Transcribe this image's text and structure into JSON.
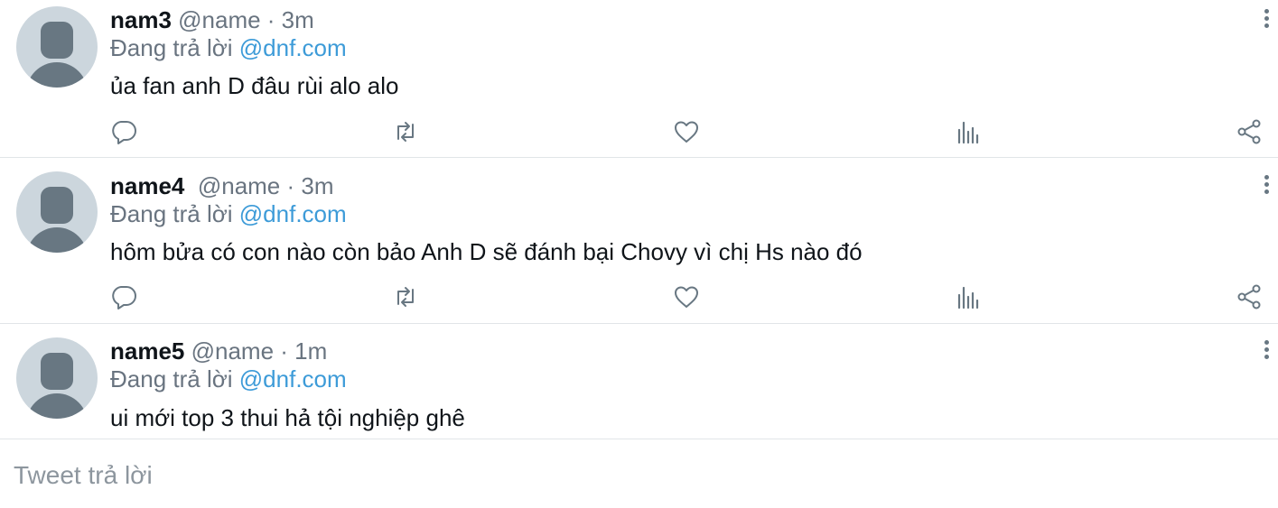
{
  "tweets": [
    {
      "name": "nam3",
      "handle_time": " @name · 3m",
      "replying_prefix": "Đang trả lời ",
      "replying_to": "@dnf.com",
      "text": "ủa fan anh D đâu rùi alo alo"
    },
    {
      "name": "name4",
      "handle_time": "  @name · 3m",
      "replying_prefix": "Đang trả lời ",
      "replying_to": "@dnf.com",
      "text": "hôm bửa có con nào còn bảo Anh D sẽ đánh bại Chovy vì chị Hs nào đó"
    },
    {
      "name": "name5",
      "handle_time": " @name · 1m",
      "replying_prefix": "Đang trả lời ",
      "replying_to": "@dnf.com",
      "text": "ui mới top 3 thui hả tội nghiệp ghê"
    }
  ],
  "icons": [
    "reply-icon",
    "retweet-icon",
    "like-icon",
    "views-icon",
    "share-icon",
    "more-icon"
  ],
  "colors": {
    "mention": "#3d9bd8",
    "secondary_text": "#697480",
    "icon": "#687782",
    "divider": "#e1e5e8"
  },
  "reply_box": {
    "placeholder": "Tweet trả lời"
  }
}
